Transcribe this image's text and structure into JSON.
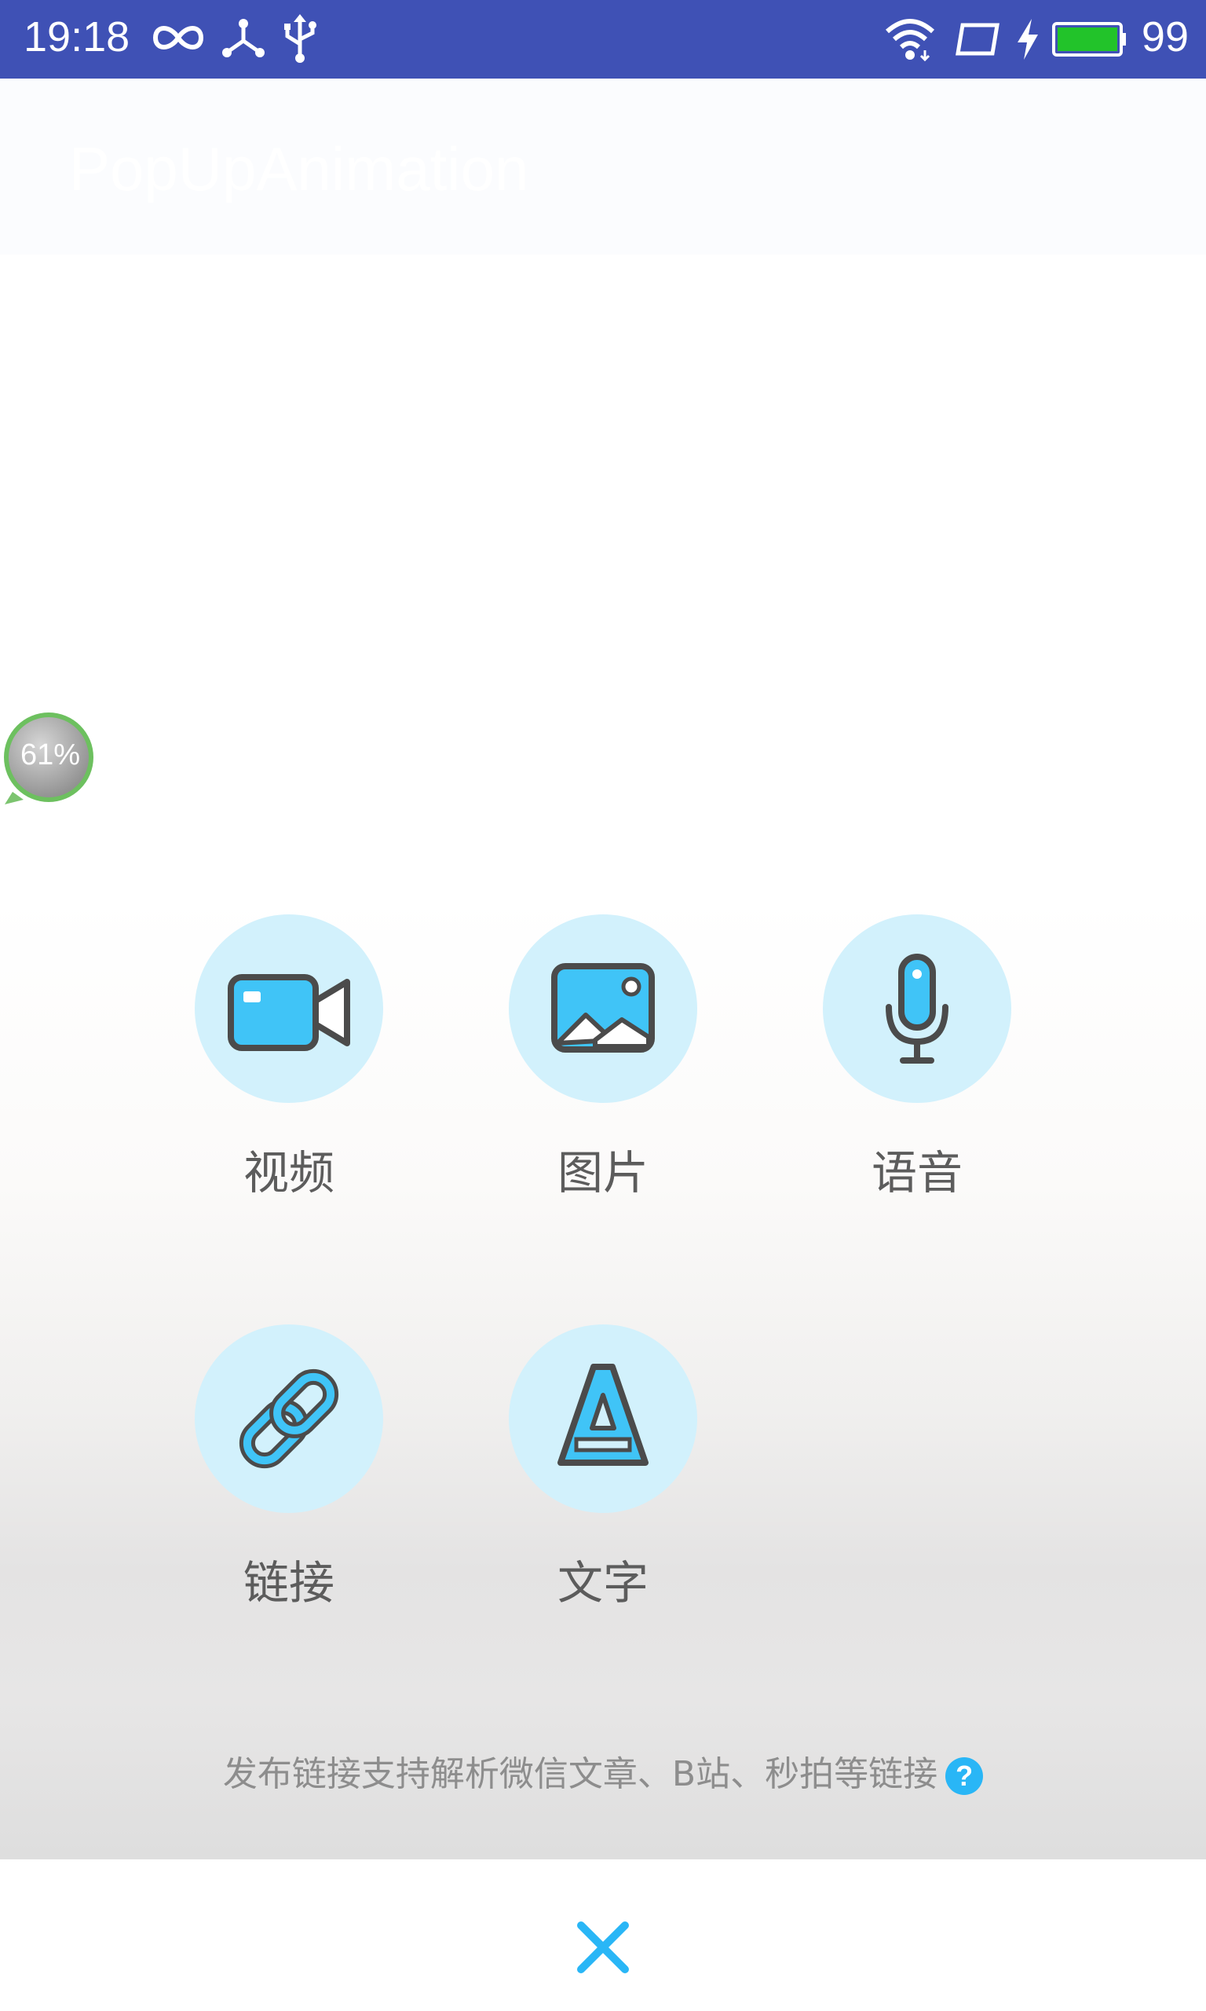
{
  "status_bar": {
    "time": "19:18",
    "battery": "99",
    "icons": [
      "infinity-icon",
      "share-nodes-icon",
      "usb-icon",
      "wifi-icon",
      "screen-rotate-icon",
      "charging-icon",
      "battery-icon"
    ],
    "bg_color": "#3f51b5"
  },
  "app_bar": {
    "title": "PopUpAnimation"
  },
  "floating_badge": {
    "text": "61%"
  },
  "menu": {
    "items": [
      {
        "label": "视频",
        "icon": "video-camera-icon"
      },
      {
        "label": "图片",
        "icon": "image-icon"
      },
      {
        "label": "语音",
        "icon": "microphone-icon"
      },
      {
        "label": "链接",
        "icon": "link-icon"
      },
      {
        "label": "文字",
        "icon": "letter-a-icon"
      }
    ],
    "accent_color": "#40c4f7",
    "circle_color": "#d2f1fc"
  },
  "hint": {
    "text": "发布链接支持解析微信文章、B站、秒拍等链接",
    "help": "?"
  },
  "close": {
    "icon": "close-icon",
    "color": "#29b6f6"
  }
}
